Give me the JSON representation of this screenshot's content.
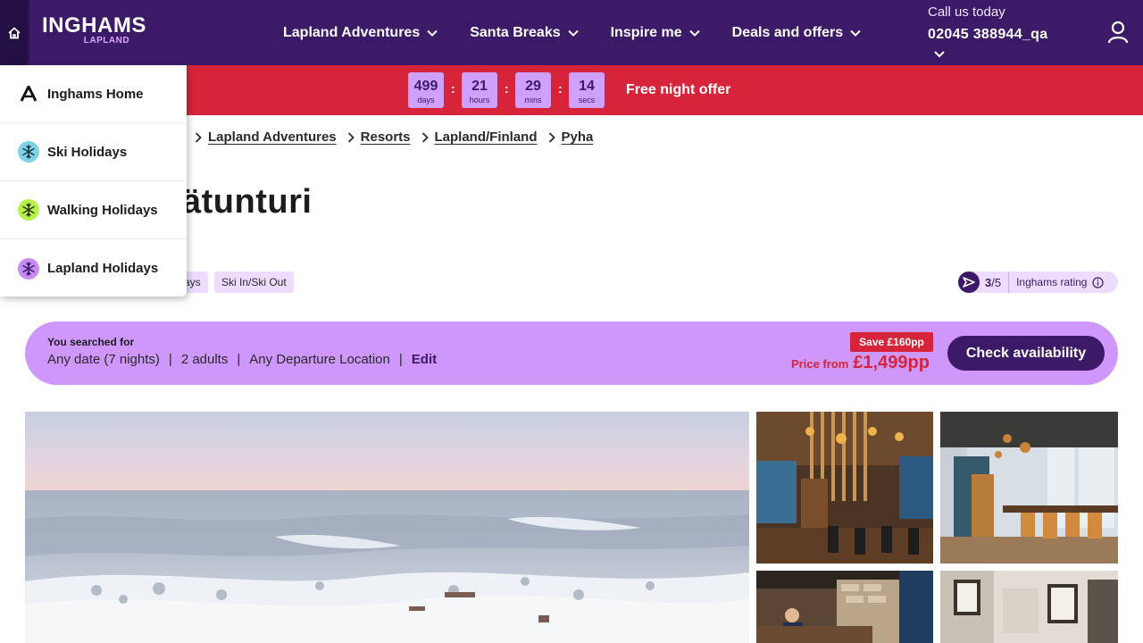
{
  "header": {
    "logo_main": "INGHAMS",
    "logo_sub": "LAPLAND",
    "nav": [
      {
        "label": "Lapland Adventures"
      },
      {
        "label": "Santa Breaks"
      },
      {
        "label": "Inspire me"
      },
      {
        "label": "Deals and offers"
      }
    ],
    "call_label": "Call us today",
    "call_number": "02045 388944_qa"
  },
  "promo": {
    "countdown": [
      {
        "value": "499",
        "unit": "days"
      },
      {
        "value": "21",
        "unit": "hours"
      },
      {
        "value": "29",
        "unit": "mins"
      },
      {
        "value": "14",
        "unit": "secs"
      }
    ],
    "separator": ":",
    "text": "Free night offer"
  },
  "breadcrumb": [
    "Lapland Adventures",
    "Resorts",
    "Lapland/Finland",
    "Pyha"
  ],
  "page_title": "ätunturi",
  "tags": [
    "ays",
    "Ski In/Ski Out"
  ],
  "rating": {
    "score": "3",
    "out_of": "/5",
    "label": "Inghams rating"
  },
  "search": {
    "label": "You searched for",
    "date": "Any date (7 nights)",
    "guests": "2 adults",
    "departure": "Any Departure Location",
    "pipe": "|",
    "edit": "Edit",
    "save_badge": "Save £160pp",
    "price_from": "Price from",
    "price": "£1,499pp",
    "cta": "Check availability"
  },
  "dropdown": [
    {
      "label": "Inghams Home",
      "icon": "inghams-logo-icon"
    },
    {
      "label": "Ski Holidays",
      "icon": "snowflake-icon",
      "color": "#7fd3e6"
    },
    {
      "label": "Walking Holidays",
      "icon": "snowflake-icon",
      "color": "#b7f04a"
    },
    {
      "label": "Lapland Holidays",
      "icon": "snowflake-icon",
      "color": "#c98cf5"
    }
  ],
  "colors": {
    "brand_purple": "#3c1a67",
    "promo_red": "#d6253a",
    "lilac": "#cf96fb",
    "tag_bg": "#eddcff"
  }
}
